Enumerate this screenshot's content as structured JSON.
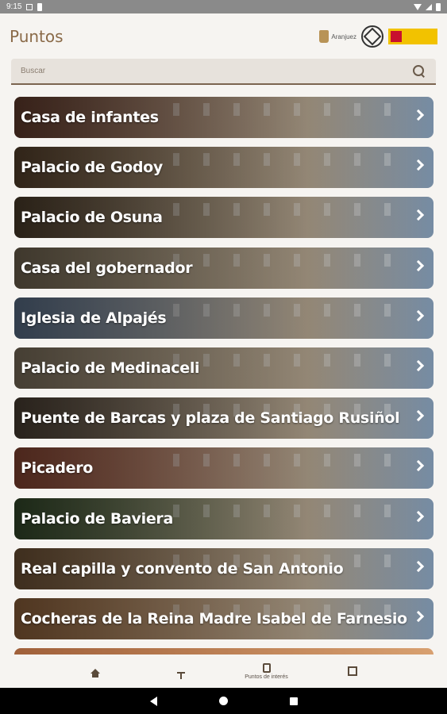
{
  "status": {
    "time": "9:15"
  },
  "header": {
    "title": "Puntos",
    "logo_text": "Aranjuez"
  },
  "search": {
    "placeholder": "Buscar"
  },
  "items": [
    {
      "label": "Casa de infantes",
      "bg": "#7a4a38"
    },
    {
      "label": "Palacio de Godoy",
      "bg": "#6b5036"
    },
    {
      "label": "Palacio de Osuna",
      "bg": "#5d4a34"
    },
    {
      "label": "Casa del gobernador",
      "bg": "#8b7c63"
    },
    {
      "label": "Iglesia de Alpajés",
      "bg": "#6f88a8"
    },
    {
      "label": "Palacio de Medinaceli",
      "bg": "#9a8a72"
    },
    {
      "label": "Puente de Barcas y plaza de Santiago Rusiñol",
      "bg": "#5a4c3e"
    },
    {
      "label": "Picadero",
      "bg": "#a8553e"
    },
    {
      "label": "Palacio de Baviera",
      "bg": "#3f5a34"
    },
    {
      "label": "Real capilla y convento de San Antonio",
      "bg": "#8a6642"
    },
    {
      "label": "Cocheras de la Reina Madre Isabel de Farnesio",
      "bg": "#b07848"
    }
  ],
  "bottom_nav": {
    "home": "",
    "dining": "",
    "poi": "Puntos de interés",
    "scan": ""
  }
}
